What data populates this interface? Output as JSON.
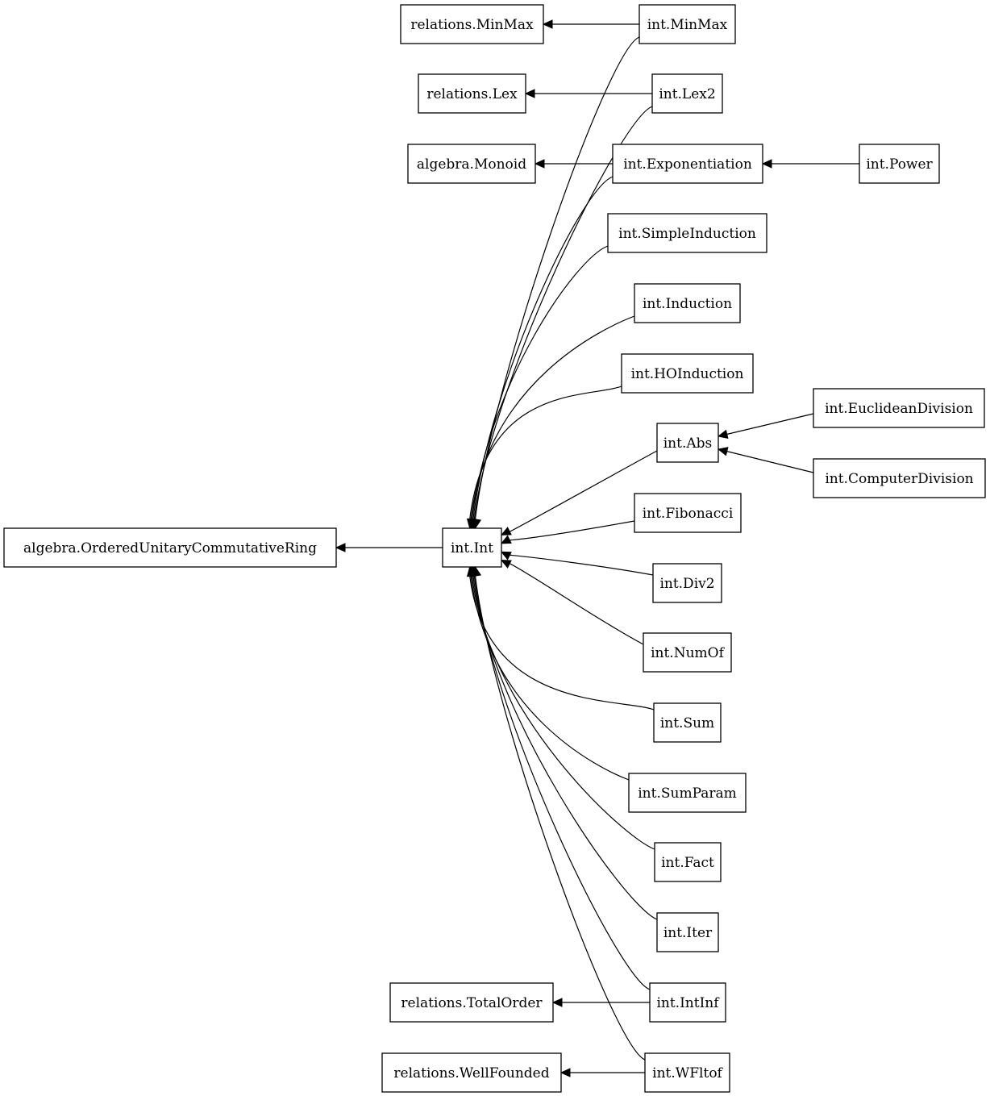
{
  "diagram": {
    "type": "dependency-graph",
    "direction": "right-to-left",
    "nodes": [
      {
        "id": "algebra.OrderedUnitaryCommutativeRing",
        "label": "algebra.OrderedUnitaryCommutativeRing"
      },
      {
        "id": "int.Int",
        "label": "int.Int"
      },
      {
        "id": "relations.MinMax",
        "label": "relations.MinMax"
      },
      {
        "id": "relations.Lex",
        "label": "relations.Lex"
      },
      {
        "id": "algebra.Monoid",
        "label": "algebra.Monoid"
      },
      {
        "id": "relations.TotalOrder",
        "label": "relations.TotalOrder"
      },
      {
        "id": "relations.WellFounded",
        "label": "relations.WellFounded"
      },
      {
        "id": "int.MinMax",
        "label": "int.MinMax"
      },
      {
        "id": "int.Lex2",
        "label": "int.Lex2"
      },
      {
        "id": "int.Exponentiation",
        "label": "int.Exponentiation"
      },
      {
        "id": "int.SimpleInduction",
        "label": "int.SimpleInduction"
      },
      {
        "id": "int.Induction",
        "label": "int.Induction"
      },
      {
        "id": "int.HOInduction",
        "label": "int.HOInduction"
      },
      {
        "id": "int.Abs",
        "label": "int.Abs"
      },
      {
        "id": "int.Fibonacci",
        "label": "int.Fibonacci"
      },
      {
        "id": "int.Div2",
        "label": "int.Div2"
      },
      {
        "id": "int.NumOf",
        "label": "int.NumOf"
      },
      {
        "id": "int.Sum",
        "label": "int.Sum"
      },
      {
        "id": "int.SumParam",
        "label": "int.SumParam"
      },
      {
        "id": "int.Fact",
        "label": "int.Fact"
      },
      {
        "id": "int.Iter",
        "label": "int.Iter"
      },
      {
        "id": "int.IntInf",
        "label": "int.IntInf"
      },
      {
        "id": "int.WFltof",
        "label": "int.WFltof"
      },
      {
        "id": "int.Power",
        "label": "int.Power"
      },
      {
        "id": "int.EuclideanDivision",
        "label": "int.EuclideanDivision"
      },
      {
        "id": "int.ComputerDivision",
        "label": "int.ComputerDivision"
      }
    ],
    "edges": [
      {
        "from": "int.Int",
        "to": "algebra.OrderedUnitaryCommutativeRing"
      },
      {
        "from": "int.MinMax",
        "to": "relations.MinMax"
      },
      {
        "from": "int.MinMax",
        "to": "int.Int"
      },
      {
        "from": "int.Lex2",
        "to": "relations.Lex"
      },
      {
        "from": "int.Lex2",
        "to": "int.Int"
      },
      {
        "from": "int.Exponentiation",
        "to": "algebra.Monoid"
      },
      {
        "from": "int.Exponentiation",
        "to": "int.Int"
      },
      {
        "from": "int.Power",
        "to": "int.Exponentiation"
      },
      {
        "from": "int.SimpleInduction",
        "to": "int.Int"
      },
      {
        "from": "int.Induction",
        "to": "int.Int"
      },
      {
        "from": "int.HOInduction",
        "to": "int.Int"
      },
      {
        "from": "int.Abs",
        "to": "int.Int"
      },
      {
        "from": "int.EuclideanDivision",
        "to": "int.Abs"
      },
      {
        "from": "int.ComputerDivision",
        "to": "int.Abs"
      },
      {
        "from": "int.Fibonacci",
        "to": "int.Int"
      },
      {
        "from": "int.Div2",
        "to": "int.Int"
      },
      {
        "from": "int.NumOf",
        "to": "int.Int"
      },
      {
        "from": "int.Sum",
        "to": "int.Int"
      },
      {
        "from": "int.SumParam",
        "to": "int.Int"
      },
      {
        "from": "int.Fact",
        "to": "int.Int"
      },
      {
        "from": "int.Iter",
        "to": "int.Int"
      },
      {
        "from": "int.IntInf",
        "to": "relations.TotalOrder"
      },
      {
        "from": "int.IntInf",
        "to": "int.Int"
      },
      {
        "from": "int.WFltof",
        "to": "relations.WellFounded"
      },
      {
        "from": "int.WFltof",
        "to": "int.Int"
      }
    ]
  }
}
